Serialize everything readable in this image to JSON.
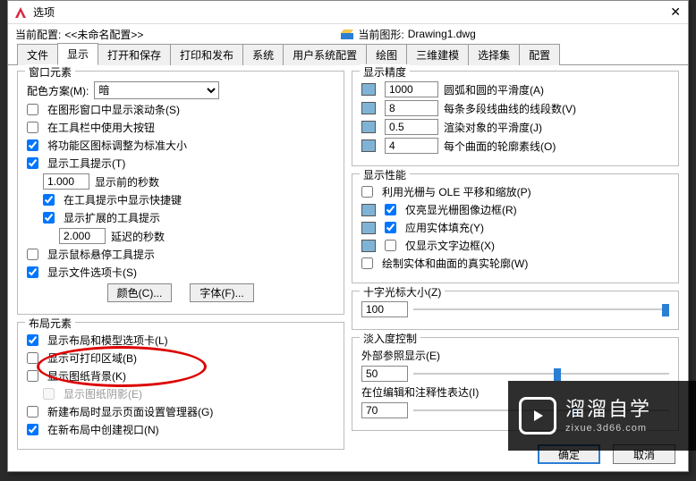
{
  "title": "选项",
  "profile": {
    "label": "当前配置:",
    "value": "<<未命名配置>>",
    "drawing_label": "当前图形:",
    "drawing_value": "Drawing1.dwg"
  },
  "tabs": [
    "文件",
    "显示",
    "打开和保存",
    "打印和发布",
    "系统",
    "用户系统配置",
    "绘图",
    "三维建模",
    "选择集",
    "配置"
  ],
  "active_tab": 1,
  "left": {
    "window_elements": {
      "legend": "窗口元素",
      "color_scheme_label": "配色方案(M):",
      "color_scheme_value": "暗",
      "scrollbars": "在图形窗口中显示滚动条(S)",
      "bigbtn": "在工具栏中使用大按钮",
      "ribbon_std": "将功能区图标调整为标准大小",
      "tooltips": "显示工具提示(T)",
      "sec_before": "1.000",
      "sec_before_label": "显示前的秒数",
      "shortcut": "在工具提示中显示快捷键",
      "ext_tip": "显示扩展的工具提示",
      "delay": "2.000",
      "delay_label": "延迟的秒数",
      "hover": "显示鼠标悬停工具提示",
      "file_tabs": "显示文件选项卡(S)",
      "color_btn": "颜色(C)...",
      "font_btn": "字体(F)..."
    },
    "layout_elements": {
      "legend": "布局元素",
      "tabs": "显示布局和模型选项卡(L)",
      "printable": "显示可打印区域(B)",
      "paper_bg": "显示图纸背景(K)",
      "paper_shadow": "显示图纸阴影(E)",
      "page_setup": "新建布局时显示页面设置管理器(G)",
      "viewport": "在新布局中创建视口(N)"
    }
  },
  "right": {
    "precision": {
      "legend": "显示精度",
      "arc": "1000",
      "arc_label": "圆弧和圆的平滑度(A)",
      "seg": "8",
      "seg_label": "每条多段线曲线的线段数(V)",
      "render": "0.5",
      "render_label": "渲染对象的平滑度(J)",
      "surf": "4",
      "surf_label": "每个曲面的轮廓素线(O)"
    },
    "performance": {
      "legend": "显示性能",
      "pan": "利用光栅与 OLE 平移和缩放(P)",
      "raster": "仅亮显光栅图像边框(R)",
      "solid": "应用实体填充(Y)",
      "textframe": "仅显示文字边框(X)",
      "silhouette": "绘制实体和曲面的真实轮廓(W)"
    },
    "crosshair": {
      "legend": "十字光标大小(Z)",
      "value": "100"
    },
    "fade": {
      "legend": "淡入度控制",
      "xref_label": "外部参照显示(E)",
      "xref_value": "50",
      "inplace_label": "在位编辑和注释性表达(I)",
      "inplace_value": "70"
    }
  },
  "buttons": {
    "ok": "确定",
    "cancel": "取消"
  },
  "watermark": {
    "text": "溜溜自学",
    "url": "zixue.3d66.com"
  }
}
